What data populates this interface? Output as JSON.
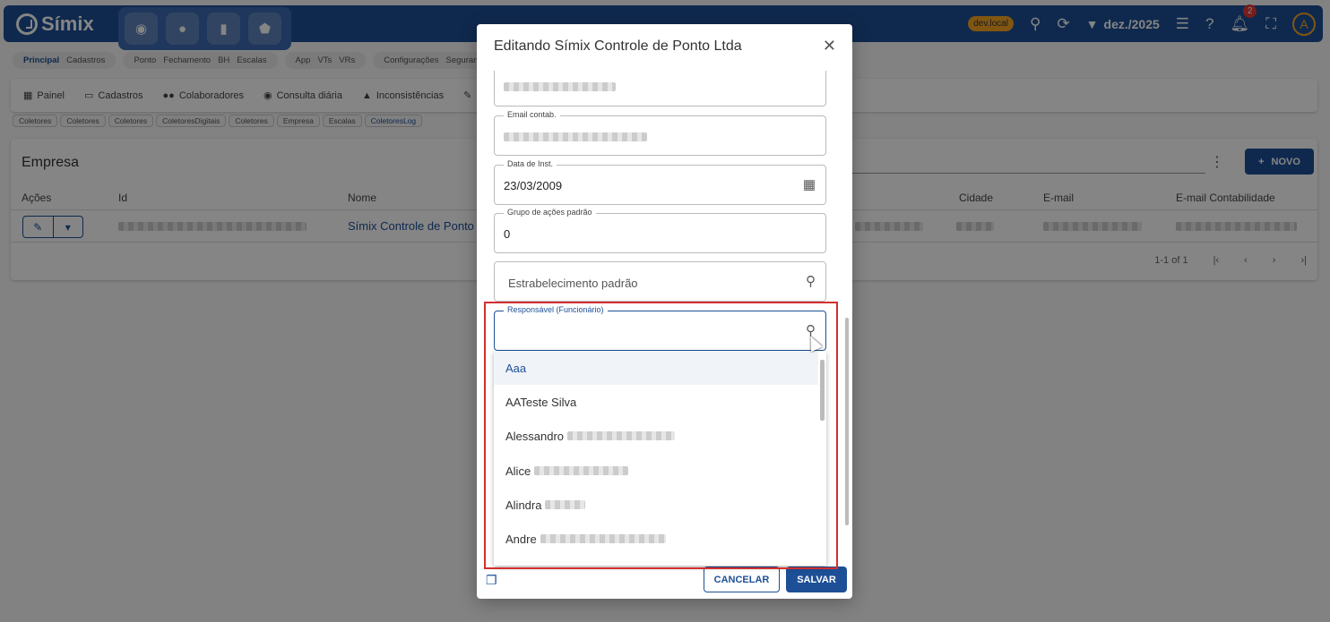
{
  "topbar": {
    "logo": "Símix",
    "nav_icons": [
      "globe-icon",
      "person-icon",
      "bar-chart-icon",
      "shield-icon"
    ],
    "env_badge": "dev.local",
    "period": "dez./2025",
    "notifications_count": "2",
    "avatar_letter": "A"
  },
  "quicknav": [
    {
      "items": [
        "Principal",
        "Cadastros"
      ],
      "active": "Principal"
    },
    {
      "items": [
        "Ponto",
        "Fechamento",
        "BH",
        "Escalas"
      ]
    },
    {
      "items": [
        "App",
        "VTs",
        "VRs"
      ]
    },
    {
      "items": [
        "Configurações",
        "Segurança"
      ]
    }
  ],
  "menu": [
    "Painel",
    "Cadastros",
    "Colaboradores",
    "Consulta diária",
    "Inconsistências"
  ],
  "tabs": [
    "Coletores",
    "Coletores",
    "Coletores",
    "ColetoresDigitais",
    "Coletores",
    "Empresa",
    "Escalas",
    "ColetoresLog"
  ],
  "card": {
    "title": "Empresa",
    "new_button": "NOVO",
    "columns": [
      "Ações",
      "Id",
      "Nome",
      "Cidade",
      "E-mail",
      "E-mail Contabilidade"
    ],
    "row_name": "Símix Controle de Ponto",
    "pagination": "1-1 of 1"
  },
  "dialog": {
    "title": "Editando Símix Controle de Ponto Ltda",
    "fields": {
      "email_label": "Email contab.",
      "date_label": "Data de Inst.",
      "date_value": "23/03/2009",
      "group_label": "Grupo de ações padrão",
      "group_value": "0",
      "establishment_placeholder": "Estrabelecimento padrão",
      "responsible_label": "Responsável (Funcionário)"
    },
    "options": [
      "Aaa",
      "AATeste Silva",
      "Alessandro",
      "Alice",
      "Alindra",
      "Andre"
    ],
    "cancel_button": "CANCELAR",
    "save_button": "SALVAR"
  },
  "colors": {
    "primary": "#1d4f96",
    "highlight": "#d32f2f",
    "badge": "#f5a623"
  }
}
